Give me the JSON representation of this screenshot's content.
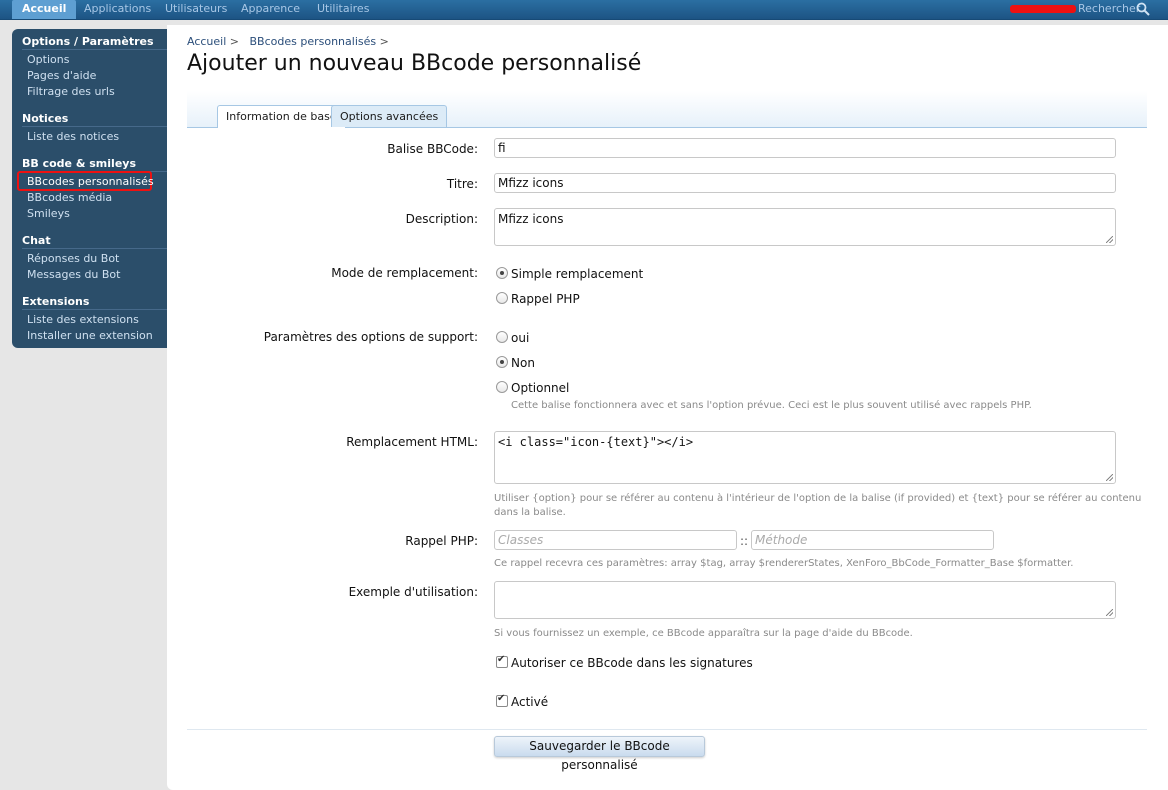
{
  "topnav": {
    "tabs": [
      "Accueil",
      "Applications",
      "Utilisateurs",
      "Apparence",
      "Utilitaires"
    ],
    "search_label": "Rechercher"
  },
  "sidebar": {
    "sections": [
      {
        "title": "Options / Paramètres",
        "items": [
          "Options",
          "Pages d'aide",
          "Filtrage des urls"
        ]
      },
      {
        "title": "Notices",
        "items": [
          "Liste des notices"
        ]
      },
      {
        "title": "BB code & smileys",
        "items": [
          "BBcodes personnalisés",
          "BBcodes média",
          "Smileys"
        ]
      },
      {
        "title": "Chat",
        "items": [
          "Réponses du Bot",
          "Messages du Bot"
        ]
      },
      {
        "title": "Extensions",
        "items": [
          "Liste des extensions",
          "Installer une extension"
        ]
      }
    ]
  },
  "breadcrumb": {
    "home": "Accueil",
    "sep1": ">",
    "section": "BBcodes personnalisés",
    "sep2": ">"
  },
  "page_title": "Ajouter un nouveau BBcode personnalisé",
  "form_tabs": [
    "Information de base",
    "Options avancées"
  ],
  "form": {
    "tag_label": "Balise BBCode:",
    "tag_value": "fi",
    "title_label": "Titre:",
    "title_value": "Mfizz icons",
    "desc_label": "Description:",
    "desc_value": "Mfizz icons",
    "mode_label": "Mode de remplacement:",
    "mode_options": [
      "Simple remplacement",
      "Rappel PHP"
    ],
    "mode_selected": "Simple remplacement",
    "support_label": "Paramètres des options de support:",
    "support_options": [
      "oui",
      "Non",
      "Optionnel"
    ],
    "support_selected": "Non",
    "support_hint": "Cette balise fonctionnera avec et sans l'option prévue. Ceci est le plus souvent utilisé avec rappels PHP.",
    "html_label": "Remplacement HTML:",
    "html_value": "<i class=\"icon-{text}\"></i>",
    "html_hint_1": "Utiliser {option} pour se référer au contenu à l'intérieur de l'option de la balise (if provided) et {text} pour se référer au contenu",
    "html_hint_2": "dans la balise.",
    "php_label": "Rappel PHP:",
    "php_class_placeholder": "Classes",
    "php_sep": "::",
    "php_method_placeholder": "Méthode",
    "php_hint": "Ce rappel recevra ces paramètres: array $tag, array $rendererStates, XenForo_BbCode_Formatter_Base $formatter.",
    "example_label": "Exemple d'utilisation:",
    "example_hint": "Si vous fournissez un exemple, ce BBcode apparaîtra sur la page d'aide du BBcode.",
    "allow_sig_label": "Autoriser ce BBcode dans les signatures",
    "allow_sig_checked": true,
    "active_label": "Activé",
    "active_checked": true,
    "save_label": "Sauvegarder le BBcode personnalisé"
  },
  "colors": {
    "topbar": "#1d5484",
    "active_tab": "#5e9fd2",
    "sidebar": "#2b4e6a",
    "highlight": "#ee1111"
  }
}
